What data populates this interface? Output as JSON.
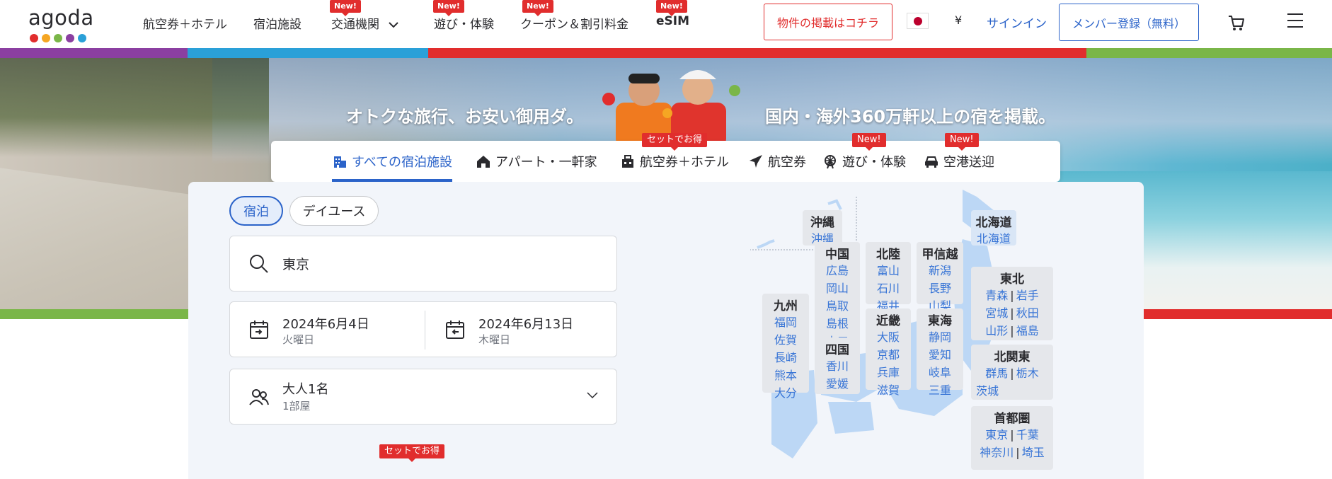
{
  "brand": {
    "logo_text": "agoda",
    "dot_colors": [
      "#e12d2d",
      "#f5a623",
      "#7ab648",
      "#8b3fa1",
      "#2aa0d8"
    ]
  },
  "nav": {
    "items": [
      {
        "label": "航空券＋ホテル",
        "new": false
      },
      {
        "label": "宿泊施設",
        "new": false
      },
      {
        "label": "交通機関",
        "new": true,
        "badge": "New!"
      },
      {
        "label": "遊び・体験",
        "new": true,
        "badge": "New!"
      },
      {
        "label": "クーポン＆割引料金",
        "new": true,
        "badge": "New!"
      },
      {
        "label": "eSIM",
        "new": true,
        "badge": "New!"
      }
    ],
    "list_property": "物件の掲載はコチラ",
    "currency": "¥",
    "signin": "サインイン",
    "register": "メンバー登録（無料）"
  },
  "hero": {
    "tagline_left": "オトクな旅行、お安い御用ダ。",
    "tagline_right": "国内・海外360万軒以上の宿を掲載。"
  },
  "categories": {
    "tabs": [
      {
        "label": "すべての宿泊施設",
        "icon": "hotel-icon",
        "active": true
      },
      {
        "label": "アパート・一軒家",
        "icon": "house-icon",
        "active": false
      },
      {
        "label": "航空券＋ホテル",
        "icon": "package-icon",
        "active": false,
        "badge": "セットでお得"
      },
      {
        "label": "航空券",
        "icon": "plane-icon",
        "active": false
      },
      {
        "label": "遊び・体験",
        "icon": "ferris-wheel-icon",
        "active": false,
        "badge": "New!"
      },
      {
        "label": "空港送迎",
        "icon": "car-icon",
        "active": false,
        "badge": "New!"
      }
    ]
  },
  "search": {
    "mode_tabs": [
      "宿泊",
      "デイユース"
    ],
    "destination": "東京",
    "checkin": {
      "date": "2024年6月4日",
      "weekday": "火曜日"
    },
    "checkout": {
      "date": "2024年6月13日",
      "weekday": "木曜日"
    },
    "guests": {
      "main": "大人1名",
      "sub": "1部屋"
    },
    "bottom_badge": "セットでお得"
  },
  "map": {
    "regions": [
      {
        "title": "沖縄",
        "prefs": [
          [
            "沖縄"
          ]
        ]
      },
      {
        "title": "北海道",
        "prefs": [
          [
            "北海道"
          ]
        ]
      },
      {
        "title": "東北",
        "prefs": [
          [
            "青森",
            "岩手"
          ],
          [
            "宮城",
            "秋田"
          ],
          [
            "山形",
            "福島"
          ]
        ]
      },
      {
        "title": "北関東",
        "prefs": [
          [
            "群馬",
            "栃木"
          ],
          [
            "茨城"
          ]
        ]
      },
      {
        "title": "首都圏",
        "prefs": [
          [
            "東京",
            "千葉"
          ],
          [
            "神奈川",
            "埼玉"
          ]
        ]
      },
      {
        "title": "中国",
        "prefs": [
          [
            "広島"
          ],
          [
            "岡山"
          ],
          [
            "鳥取"
          ],
          [
            "島根"
          ],
          [
            "山口"
          ]
        ]
      },
      {
        "title": "北陸",
        "prefs": [
          [
            "富山"
          ],
          [
            "石川"
          ],
          [
            "福井"
          ]
        ]
      },
      {
        "title": "甲信越",
        "prefs": [
          [
            "新潟"
          ],
          [
            "長野"
          ],
          [
            "山梨"
          ]
        ]
      },
      {
        "title": "近畿",
        "prefs": [
          [
            "大阪"
          ],
          [
            "京都"
          ],
          [
            "兵庫"
          ],
          [
            "滋賀"
          ]
        ]
      },
      {
        "title": "東海",
        "prefs": [
          [
            "静岡"
          ],
          [
            "愛知"
          ],
          [
            "岐阜"
          ],
          [
            "三重"
          ]
        ]
      },
      {
        "title": "九州",
        "prefs": [
          [
            "福岡"
          ],
          [
            "佐賀"
          ],
          [
            "長崎"
          ],
          [
            "熊本"
          ],
          [
            "大分"
          ]
        ]
      },
      {
        "title": "四国",
        "prefs": [
          [
            "香川"
          ],
          [
            "愛媛"
          ]
        ]
      }
    ]
  },
  "colors": {
    "brand_blue": "#2b63c9",
    "badge_red": "#e12d2d",
    "link_blue": "#3774d6",
    "panel_bg": "#f2f5fa"
  }
}
